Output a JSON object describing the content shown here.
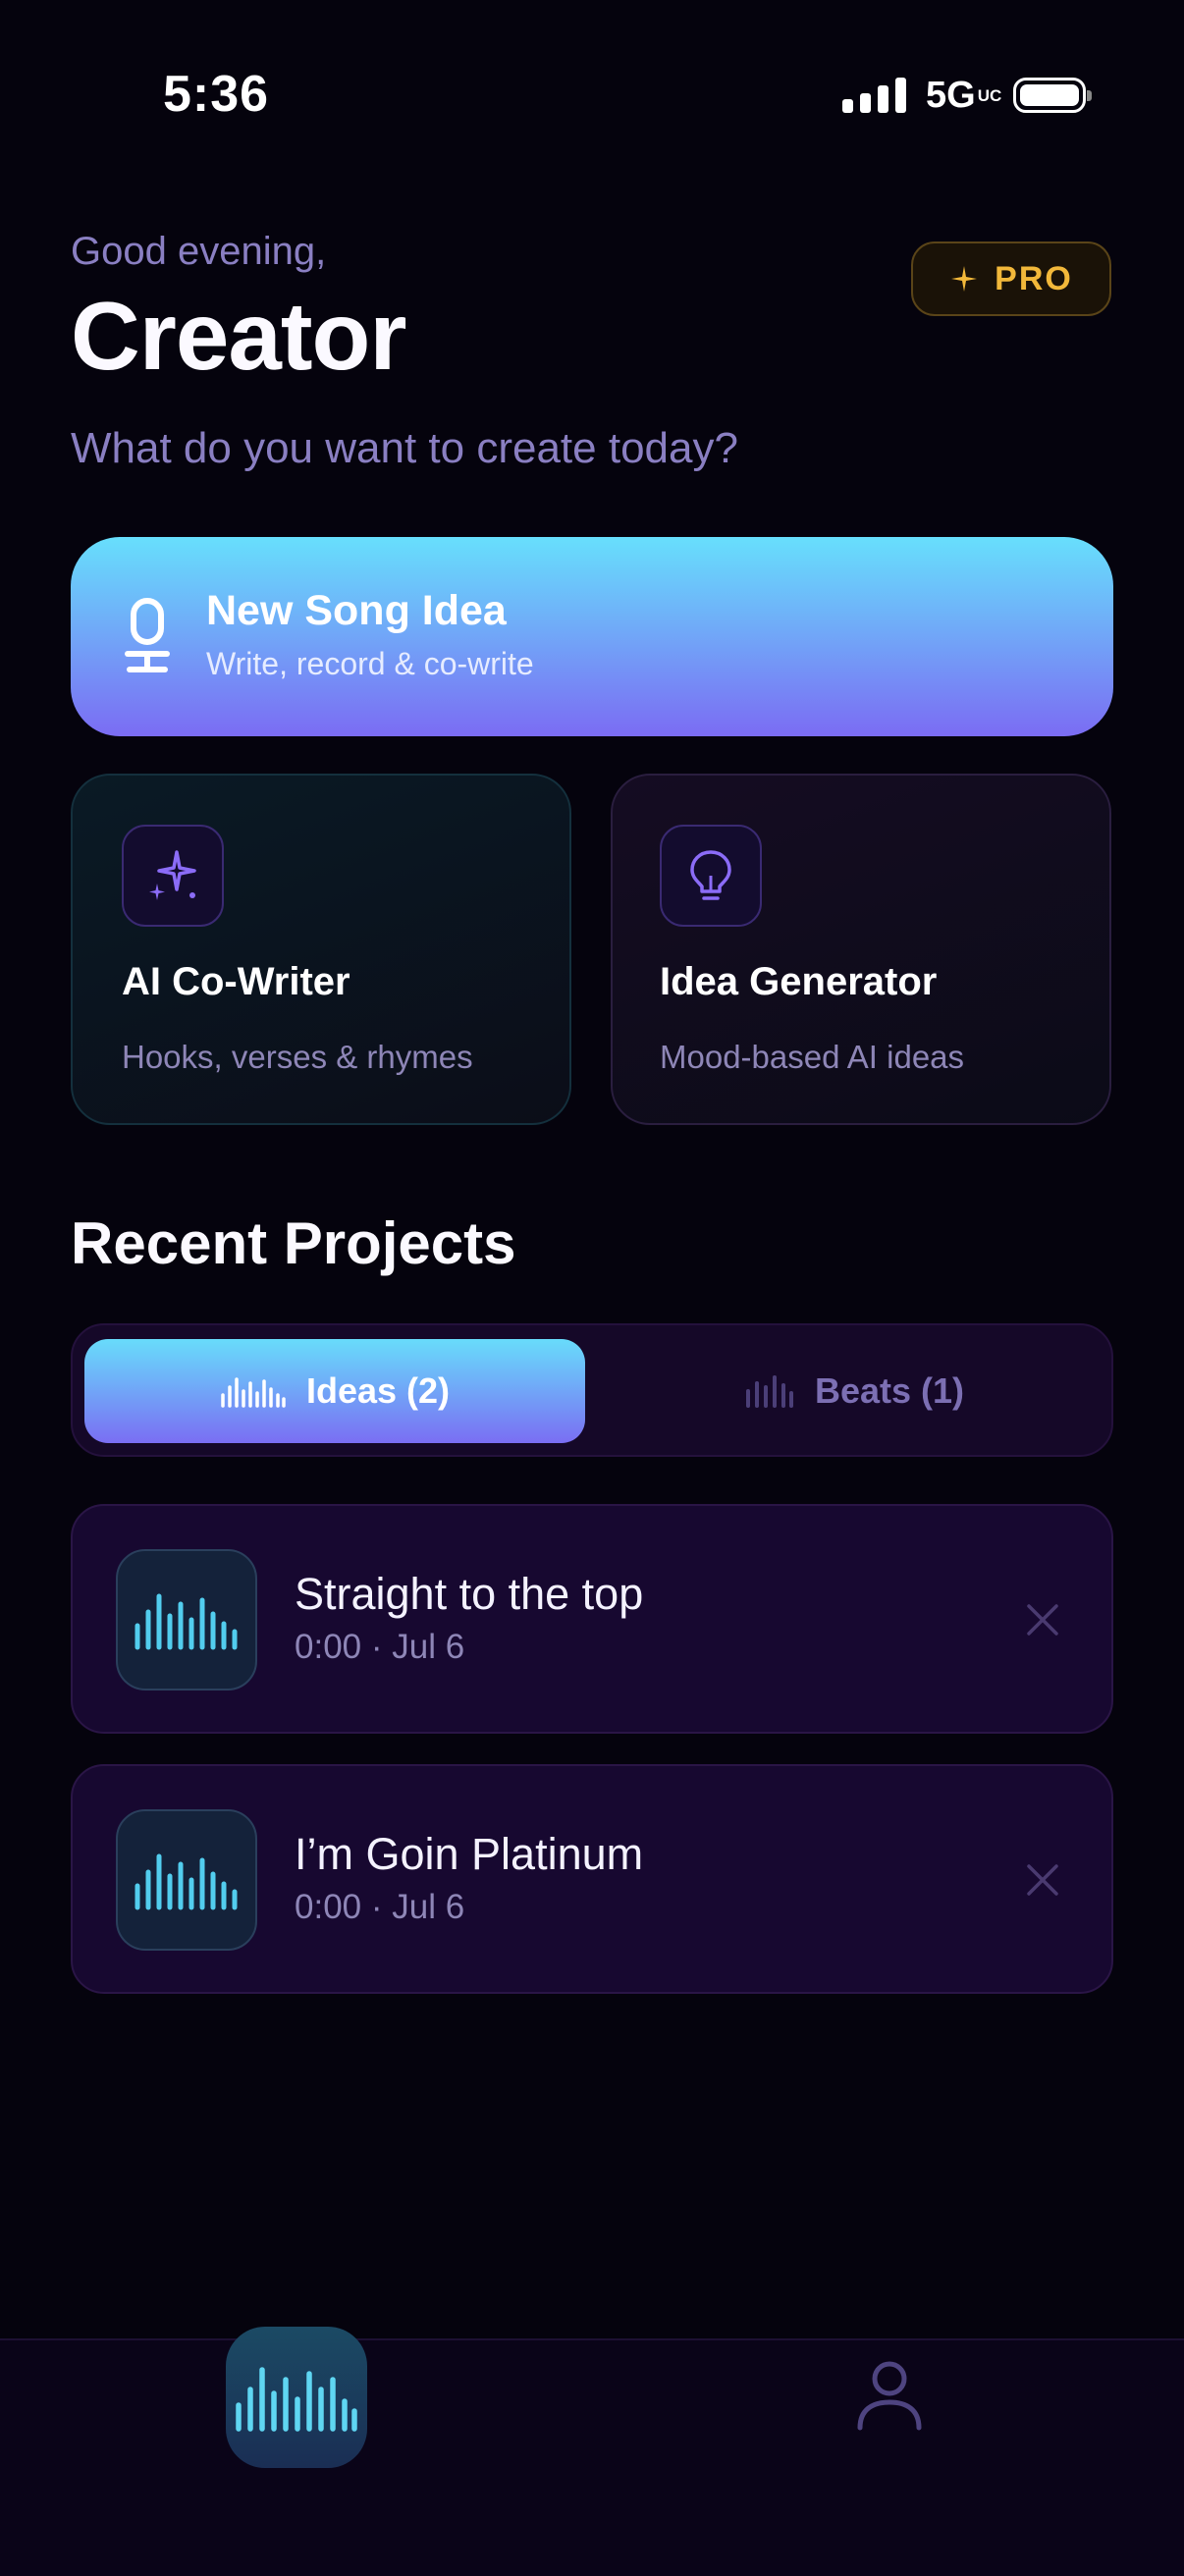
{
  "status_bar": {
    "time": "5:36",
    "network": "5G",
    "network_suffix": "UC"
  },
  "header": {
    "greeting": "Good evening,",
    "name": "Creator",
    "pro_label": "PRO",
    "subtitle": "What do you want to create today?"
  },
  "new_song": {
    "title": "New Song Idea",
    "subtitle": "Write, record & co-write",
    "icon": "microphone-icon"
  },
  "cards": [
    {
      "title": "AI Co-Writer",
      "subtitle": "Hooks, verses & rhymes",
      "icon": "sparkles-icon"
    },
    {
      "title": "Idea Generator",
      "subtitle": "Mood-based AI ideas",
      "icon": "lightbulb-icon"
    }
  ],
  "recent": {
    "title": "Recent Projects",
    "tabs": [
      {
        "label": "Ideas (2)",
        "active": true
      },
      {
        "label": "Beats (1)",
        "active": false
      }
    ],
    "items": [
      {
        "title": "Straight to the top",
        "meta": "0:00 · Jul 6"
      },
      {
        "title": "I’m Goin Platinum",
        "meta": "0:00 · Jul 6"
      }
    ]
  },
  "nav": {
    "items": [
      "waveform-icon",
      "profile-icon"
    ],
    "active_index": 0
  },
  "colors": {
    "background": "#05030d",
    "accent_cyan": "#67dffc",
    "accent_violet": "#7b6cf3",
    "pro_gold": "#f2b83a",
    "muted_text": "#8a7fc2"
  }
}
